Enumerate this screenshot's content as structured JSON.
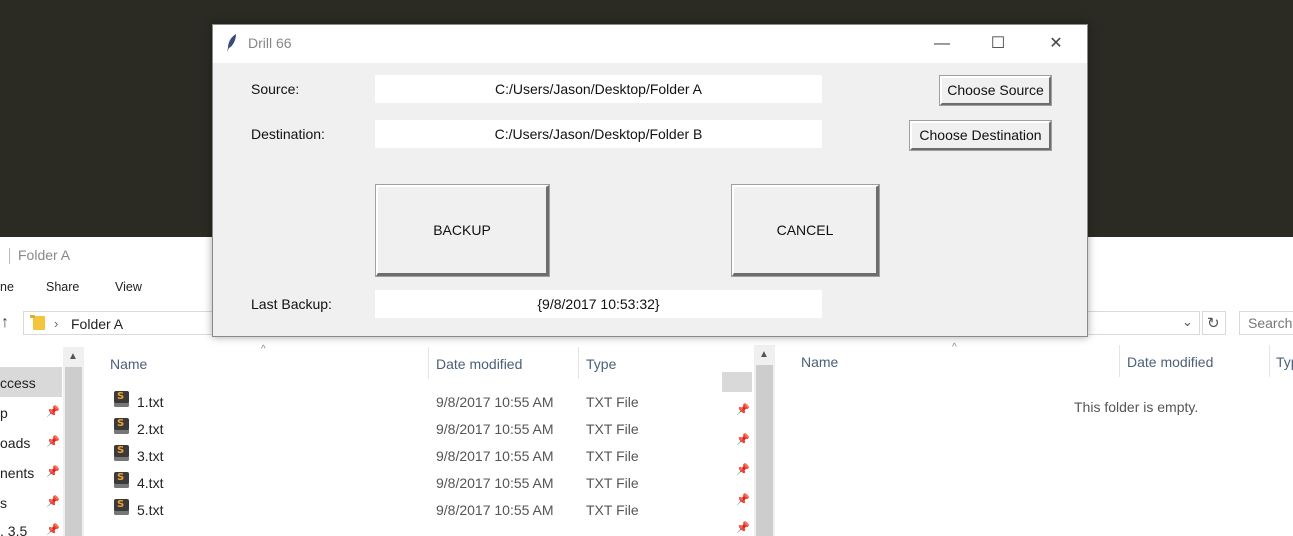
{
  "dialog": {
    "title": "Drill 66",
    "source_label": "Source:",
    "source_value": "C:/Users/Jason/Desktop/Folder A",
    "choose_source": "Choose Source",
    "destination_label": "Destination:",
    "destination_value": "C:/Users/Jason/Desktop/Folder B",
    "choose_destination": "Choose Destination",
    "backup": "BACKUP",
    "cancel": "CANCEL",
    "last_backup_label": "Last Backup:",
    "last_backup_value": "{9/8/2017  10:53:32}",
    "minimize_glyph": "—",
    "maximize_glyph": "☐",
    "close_glyph": "✕"
  },
  "explorer_left": {
    "title": "Folder A",
    "ribbon_tabs": [
      "ne",
      "Share",
      "View"
    ],
    "breadcrumb": "Folder A",
    "nav_items": [
      "ccess",
      "p",
      "oads",
      "nents",
      "s",
      ". 3.5"
    ],
    "columns": {
      "name": "Name",
      "date": "Date modified",
      "type": "Type"
    },
    "files": [
      {
        "name": "1.txt",
        "date": "9/8/2017 10:55 AM",
        "type": "TXT File"
      },
      {
        "name": "2.txt",
        "date": "9/8/2017 10:55 AM",
        "type": "TXT File"
      },
      {
        "name": "3.txt",
        "date": "9/8/2017 10:55 AM",
        "type": "TXT File"
      },
      {
        "name": "4.txt",
        "date": "9/8/2017 10:55 AM",
        "type": "TXT File"
      },
      {
        "name": "5.txt",
        "date": "9/8/2017 10:55 AM",
        "type": "TXT File"
      }
    ]
  },
  "explorer_right": {
    "columns": {
      "name": "Name",
      "date": "Date modified",
      "type": "Typ"
    },
    "empty_message": "This folder is empty.",
    "search_placeholder": "Search"
  },
  "icons": {
    "file_icon": "sublime-text-file-icon",
    "pin_icon": "pin-icon",
    "folder_icon": "folder-icon",
    "refresh_icon": "refresh-icon",
    "feather_icon": "tk-feather-icon"
  }
}
